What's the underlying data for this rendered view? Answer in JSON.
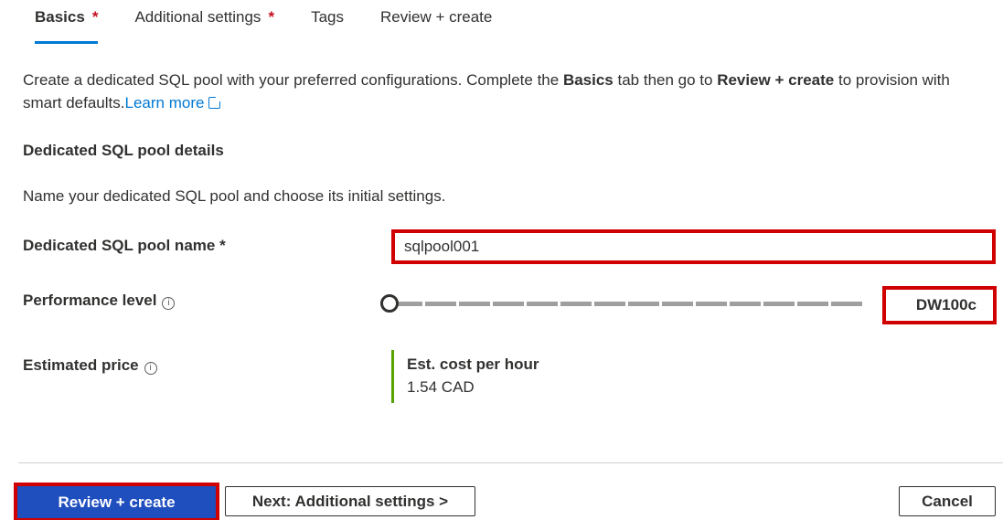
{
  "tabs": [
    {
      "label": "Basics",
      "required": "*",
      "active": true
    },
    {
      "label": "Additional settings",
      "required": "*",
      "active": false
    },
    {
      "label": "Tags",
      "required": "",
      "active": false
    },
    {
      "label": "Review + create",
      "required": "",
      "active": false
    }
  ],
  "intro": {
    "part1": "Create a dedicated SQL pool with your preferred configurations. Complete the ",
    "bold1": "Basics",
    "part2": " tab then go to ",
    "bold2": "Review + create",
    "part3": " to provision with smart defaults.",
    "link": "Learn more"
  },
  "section": {
    "title": "Dedicated SQL pool details",
    "description": "Name your dedicated SQL pool and choose its initial settings."
  },
  "fields": {
    "pool_name_label": "Dedicated SQL pool name *",
    "pool_name_value": "sqlpool001",
    "performance_label": "Performance level",
    "performance_value": "DW100c",
    "performance_slider_position": 0,
    "estimated_price_label": "Estimated price",
    "price_title": "Est. cost per hour",
    "price_value": "1.54 CAD"
  },
  "icons": {
    "info": "info-icon",
    "external_link": "external-link-icon"
  },
  "info_glyph": "i",
  "buttons": {
    "review_create": "Review + create",
    "next": "Next: Additional settings >",
    "cancel": "Cancel"
  },
  "colors": {
    "accent": "#0078d4",
    "primary_button": "#1f4ebf",
    "required": "#c50f1f",
    "highlight": "#d00000",
    "price_bar": "#57a300"
  }
}
